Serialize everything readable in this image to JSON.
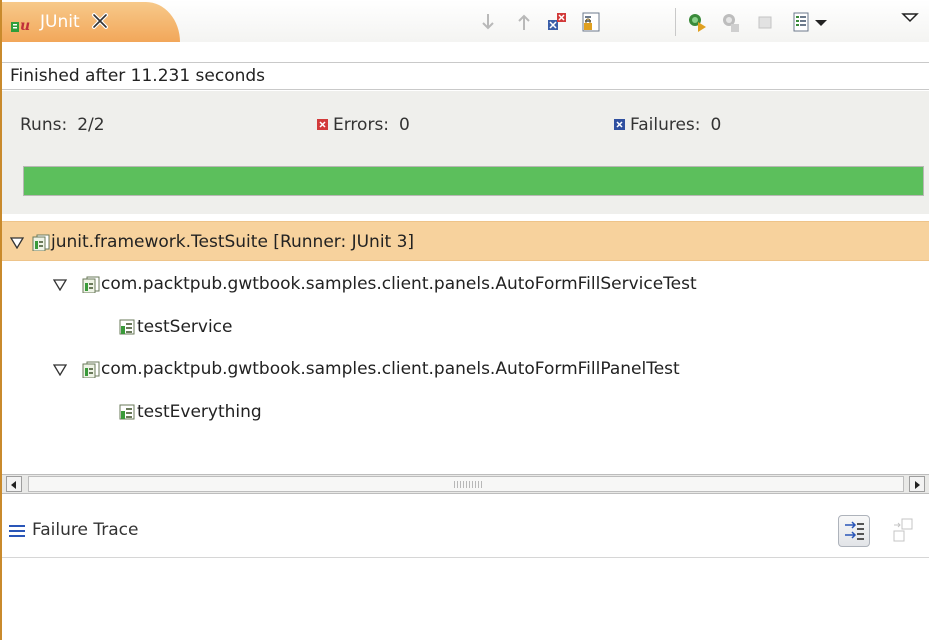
{
  "tab": {
    "label": "JUnit"
  },
  "status": {
    "text": "Finished after 11.231 seconds"
  },
  "counters": {
    "runs_label": "Runs:",
    "runs_value": "2/2",
    "errors_label": "Errors:",
    "errors_value": "0",
    "failures_label": "Failures:",
    "failures_value": "0"
  },
  "progress": {
    "fraction": 1.0,
    "color": "#5cbf5c"
  },
  "tree": {
    "nodes": [
      {
        "label": "junit.framework.TestSuite [Runner: JUnit 3]"
      },
      {
        "label": "com.packtpub.gwtbook.samples.client.panels.AutoFormFillServiceTest"
      },
      {
        "label": "testService"
      },
      {
        "label": "com.packtpub.gwtbook.samples.client.panels.AutoFormFillPanelTest"
      },
      {
        "label": "testEverything"
      }
    ]
  },
  "trace": {
    "title": "Failure Trace"
  },
  "toolbar_icons": [
    "next-failure-icon",
    "previous-failure-icon",
    "show-failures-only-icon",
    "scroll-lock-icon",
    "rerun-icon",
    "rerun-failed-first-icon",
    "stop-icon",
    "test-run-history-icon",
    "view-menu-icon"
  ],
  "colors": {
    "accent_tab": "#f2a75a",
    "selection": "#f7d29d",
    "success": "#5cbf5c",
    "error": "#d23a3a",
    "failure": "#3050a0"
  }
}
